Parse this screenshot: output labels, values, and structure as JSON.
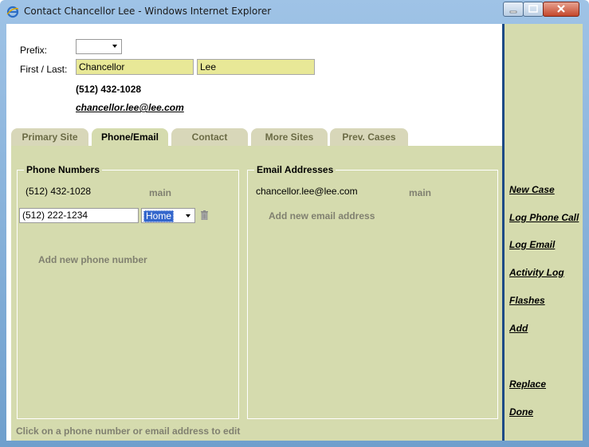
{
  "window": {
    "title": "Contact Chancellor Lee - Windows Internet Explorer"
  },
  "form": {
    "prefix_label": "Prefix:",
    "prefix_value": "",
    "name_label": "First / Last:",
    "first_name": "Chancellor",
    "last_name": "Lee",
    "main_phone": "(512) 432-1028",
    "main_email": "chancellor.lee@lee.com"
  },
  "tabs": [
    {
      "label": "Primary Site",
      "active": false
    },
    {
      "label": "Phone/Email",
      "active": true
    },
    {
      "label": "Contact",
      "active": false
    },
    {
      "label": "More Sites",
      "active": false
    },
    {
      "label": "Prev. Cases",
      "active": false
    }
  ],
  "phone_panel": {
    "title": "Phone Numbers",
    "entries": [
      {
        "number": "(512) 432-1028",
        "type": "main"
      }
    ],
    "edit_value": "(512) 222-1234",
    "edit_type": "Home",
    "add_link": "Add new phone number"
  },
  "email_panel": {
    "title": "Email Addresses",
    "entries": [
      {
        "address": "chancellor.lee@lee.com",
        "type": "main"
      }
    ],
    "add_link": "Add new email address"
  },
  "footer_hint": "Click on a phone number or email address to edit",
  "actions": [
    "New Case",
    "Log Phone Call",
    "Log Email",
    "Activity Log",
    "Flashes",
    "Add",
    "Replace",
    "Done"
  ],
  "colors": {
    "panel_bg": "#d5dbae",
    "name_field_bg": "#e8e897",
    "sidebar_border": "#1d4a86",
    "selected_option_bg": "#3366cc"
  }
}
